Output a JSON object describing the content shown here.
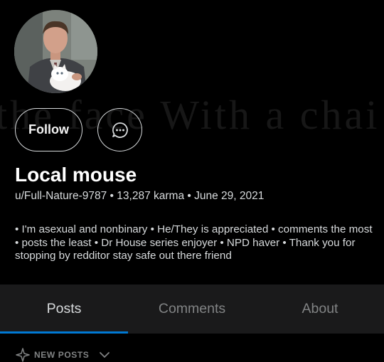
{
  "banner": {
    "text": "the face  With a chai"
  },
  "profile": {
    "display_name": "Local mouse",
    "username": "u/Full-Nature-9787",
    "karma": "13,287 karma",
    "cake_day": "June 29, 2021",
    "separator": "•",
    "bio": "• I'm asexual and nonbinary • He/They is appreciated • comments the most • posts the least • Dr House series enjoyer • NPD haver • Thank you for stopping by redditor stay safe out there friend"
  },
  "actions": {
    "follow_label": "Follow",
    "chat_icon": "chat-bubble-icon"
  },
  "tabs": [
    {
      "label": "Posts",
      "active": true
    },
    {
      "label": "Comments",
      "active": false
    },
    {
      "label": "About",
      "active": false
    }
  ],
  "sort": {
    "label": "NEW POSTS",
    "icon": "sparkle-icon"
  },
  "colors": {
    "accent": "#0079d3",
    "background": "#000000",
    "tabbar": "#1a1a1b"
  }
}
